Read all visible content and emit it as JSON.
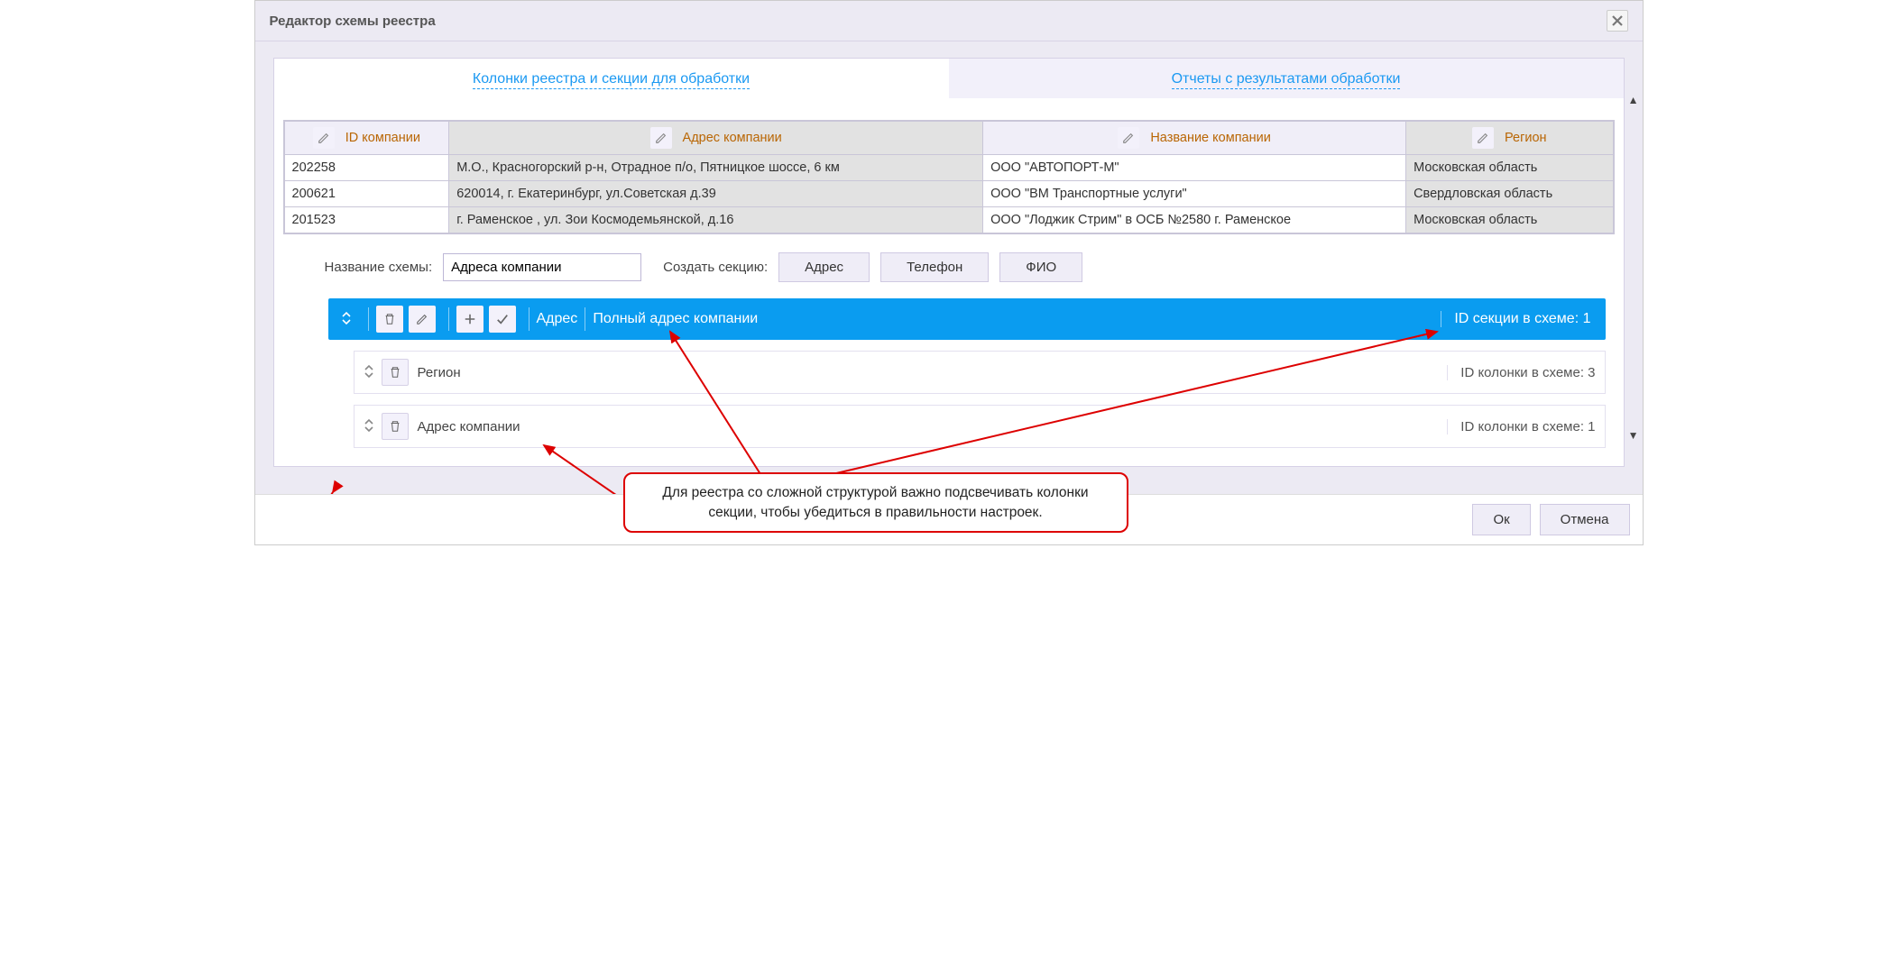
{
  "dialog": {
    "title": "Редактор схемы реестра"
  },
  "tabs": {
    "columns": "Колонки реестра и секции для обработки",
    "reports": "Отчеты с результатами обработки"
  },
  "grid": {
    "headers": {
      "id": "ID компании",
      "address": "Адрес компании",
      "name": "Название компании",
      "region": "Регион"
    },
    "rows": [
      {
        "id": "202258",
        "address": "М.О., Красногорский р-н, Отрадное п/о, Пятницкое шоссе, 6 км",
        "name": "ООО \"АВТОПОРТ-М\"",
        "region": "Московская область"
      },
      {
        "id": "200621",
        "address": "620014, г. Екатеринбург, ул.Советская д.39",
        "name": "ООО \"ВМ Транспортные услуги\"",
        "region": "Свердловская область"
      },
      {
        "id": "201523",
        "address": "г. Раменское , ул. Зои Космодемьянской, д.16",
        "name": "ООО \"Лоджик Стрим\" в ОСБ №2580 г. Раменское",
        "region": "Московская область"
      }
    ]
  },
  "form": {
    "scheme_name_label": "Название схемы:",
    "scheme_name_value": "Адреса компании",
    "create_section_label": "Создать секцию:",
    "buttons": {
      "address": "Адрес",
      "phone": "Телефон",
      "fio": "ФИО"
    }
  },
  "section": {
    "type_label": "Адрес",
    "title": "Полный адрес компании",
    "id_label": "ID секции в схеме: 1",
    "columns": [
      {
        "name": "Регион",
        "meta": "ID колонки в схеме: 3"
      },
      {
        "name": "Адрес компании",
        "meta": "ID колонки в схеме: 1"
      }
    ]
  },
  "callout": {
    "text": "Для реестра со сложной структурой важно подсвечивать колонки секции, чтобы убедиться в правильности настроек."
  },
  "footer": {
    "ok": "Ок",
    "cancel": "Отмена"
  }
}
